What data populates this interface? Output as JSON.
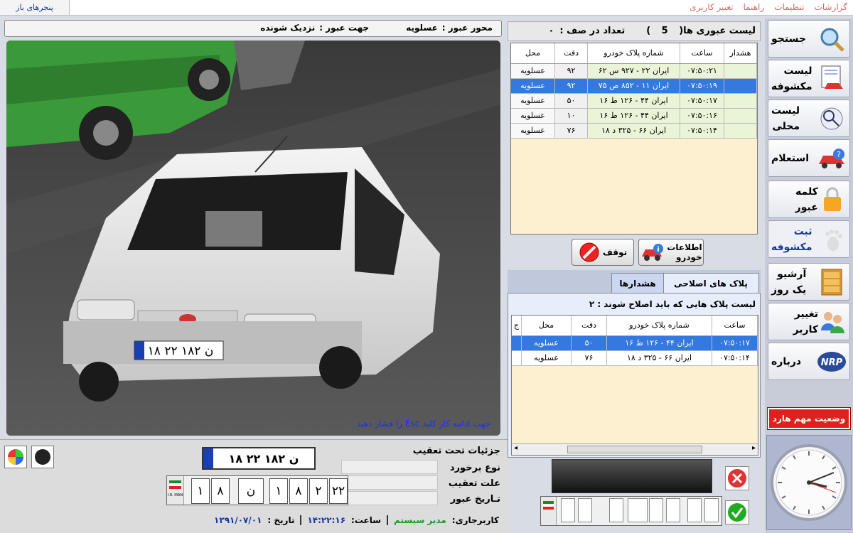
{
  "menu": {
    "items": [
      "گزارشات",
      "تنظیمات",
      "راهنما",
      "تغییر کاربری"
    ],
    "open_windows": "پنجرهای باز"
  },
  "info_bar": {
    "axis_label": "محور عبور :",
    "axis_value": "عسلویه",
    "direction_label": "جهت عبور :",
    "direction_value": "نزدیک شونده"
  },
  "photo": {
    "esc_hint": "جهت ادامه کار کلید Esc را فشار دهید",
    "plate_text": "۱۸ ن ۱۸۲ ۲۲"
  },
  "transit_list": {
    "title": "لیست عبوری ها(",
    "count": "5",
    "close_paren": ")",
    "queue_label": "تعداد در صف :",
    "queue_value": "۰",
    "columns": [
      "هشدار",
      "ساعت",
      "شماره پلاک خودرو",
      "دقت",
      "محل"
    ],
    "rows": [
      {
        "alert": "",
        "time": "۰۷:۵۰:۲۱",
        "plate": "ایران ۲۲ - ۹۲۷ س ۶۲",
        "accuracy": "۹۲",
        "location": "عسلویه",
        "selected": false
      },
      {
        "alert": "",
        "time": "۰۷:۵۰:۱۹",
        "plate": "ایران ۱۱ - ۸۵۲ ص ۷۵",
        "accuracy": "۹۲",
        "location": "عسلویه",
        "selected": true
      },
      {
        "alert": "",
        "time": "۰۷:۵۰:۱۷",
        "plate": "ایران ۴۴ - ۱۲۶ ط ۱۶",
        "accuracy": "۵۰",
        "location": "عسلویه",
        "selected": false
      },
      {
        "alert": "",
        "time": "۰۷:۵۰:۱۶",
        "plate": "ایران ۴۴ - ۱۲۶ ط ۱۶",
        "accuracy": "۱۰",
        "location": "عسلویه",
        "selected": false
      },
      {
        "alert": "",
        "time": "۰۷:۵۰:۱۴",
        "plate": "ایران ۶۶ - ۳۲۵ د ۱۸",
        "accuracy": "۷۶",
        "location": "عسلویه",
        "selected": false
      }
    ]
  },
  "actions": {
    "vehicle_info": "اطلاعات\nخودرو",
    "stop": "توقف"
  },
  "tabs": {
    "corrections": "پلاک های اصلاحی",
    "alerts": "هشدارها"
  },
  "correction_list": {
    "title": "لیست پلاک هایی  که باید اصلاح شوند : ۲",
    "columns": [
      "ساعت",
      "شماره پلاک خودرو",
      "دقت",
      "محل",
      "ج"
    ],
    "rows": [
      {
        "time": "۰۷:۵۰:۱۷",
        "plate": "ایران ۴۴ - ۱۲۶ ط ۱۶",
        "accuracy": "۵۰",
        "location": "عسلویه",
        "selected": true
      },
      {
        "time": "۰۷:۵۰:۱۴",
        "plate": "ایران ۶۶ - ۳۲۵ د ۱۸",
        "accuracy": "۷۶",
        "location": "عسلویه",
        "selected": false
      }
    ]
  },
  "details": {
    "title": "جزئیات تحت تعقیب",
    "encounter_label": "نوع برخورد",
    "reason_label": "علت تعقیب",
    "date_label": "تـاریخ عبور",
    "plate_crop_text": "۱۸ ن ۱۸۲ ۲۲",
    "plate_chars": [
      "۲۲",
      "۲",
      "۸",
      "۱",
      "ن",
      "۸",
      "۱"
    ],
    "iran_label": "I.R. IRAN"
  },
  "status": {
    "operator_label": "کاربرجاری:",
    "operator_value": "مدیر سیستم",
    "time_label": "ساعت:",
    "time_value": "۱۴:۲۲:۱۶",
    "date_label": "تاریخ :",
    "date_value": "۱۳۹۱/۰۷/۰۱"
  },
  "sidebar": {
    "buttons": [
      {
        "label": "جستجو",
        "icon": "magnifier-icon"
      },
      {
        "label": "لیست\nمکشوفه",
        "icon": "document-car-icon"
      },
      {
        "label": "لیست\nمحلی",
        "icon": "local-search-icon"
      },
      {
        "label": "استعلام",
        "icon": "car-inquiry-icon"
      },
      {
        "label": "کلمه عبور",
        "icon": "lock-icon"
      },
      {
        "label": "ثبت\nمکشوفه",
        "icon": "footprint-icon"
      },
      {
        "label": "آرشیو\nیک روز",
        "icon": "archive-cabinet-icon"
      },
      {
        "label": "تغییر کاربر",
        "icon": "users-icon"
      },
      {
        "label": "درباره",
        "icon": "nrp-logo-icon"
      }
    ],
    "alert": "وضعیت مهم هارد"
  },
  "colors": {
    "selected_row": "#3478e0",
    "row_green": "#eaf5d8",
    "grid_bg": "#fdf0d0",
    "alert_red": "#e02020",
    "operator_green": "#1a9a20",
    "status_blue": "#1536a0"
  }
}
